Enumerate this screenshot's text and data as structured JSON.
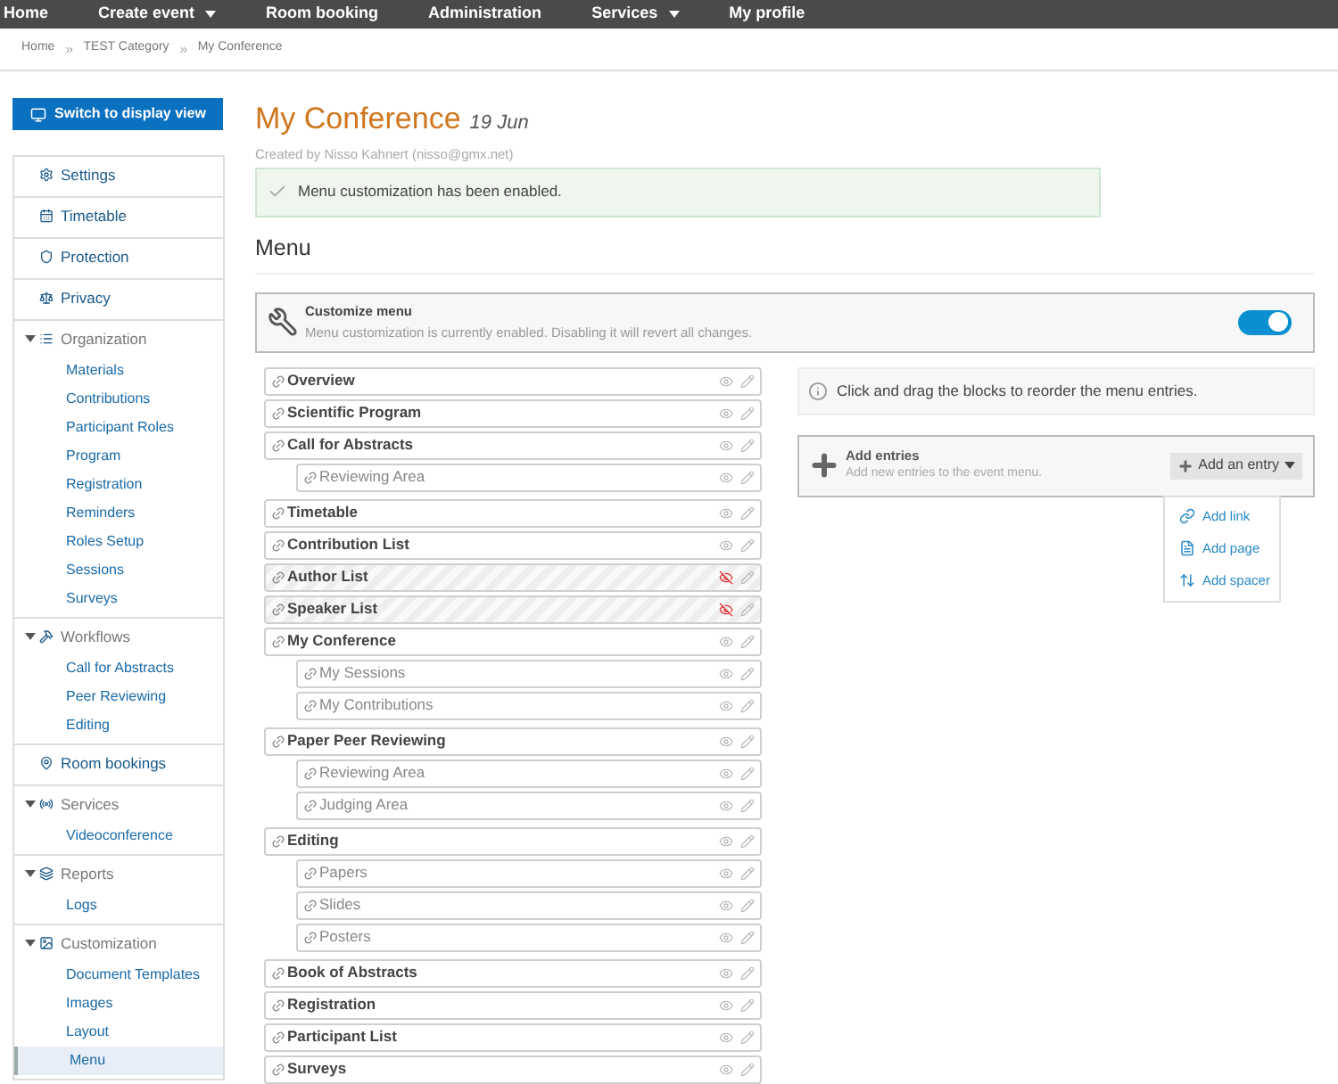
{
  "nav": [
    {
      "label": "Home",
      "dropdown": false
    },
    {
      "label": "Create event",
      "dropdown": true
    },
    {
      "label": "Room booking",
      "dropdown": false
    },
    {
      "label": "Administration",
      "dropdown": false
    },
    {
      "label": "Services",
      "dropdown": true
    },
    {
      "label": "My profile",
      "dropdown": false
    }
  ],
  "breadcrumb": [
    "Home",
    "TEST Category",
    "My Conference"
  ],
  "sidebar": {
    "display_view_button": "Switch to display view",
    "sections": [
      {
        "label": "Settings"
      },
      {
        "label": "Timetable"
      },
      {
        "label": "Protection"
      },
      {
        "label": "Privacy"
      },
      {
        "label": "Organization",
        "expanded": true,
        "items": [
          {
            "label": "Materials",
            "selected": false
          },
          {
            "label": "Contributions",
            "selected": false
          },
          {
            "label": "Participant Roles",
            "selected": false
          },
          {
            "label": "Program",
            "selected": false
          },
          {
            "label": "Registration",
            "selected": false
          },
          {
            "label": "Reminders",
            "selected": false
          },
          {
            "label": "Roles Setup",
            "selected": false
          },
          {
            "label": "Sessions",
            "selected": false
          },
          {
            "label": "Surveys",
            "selected": false
          }
        ]
      },
      {
        "label": "Workflows",
        "expanded": true,
        "items": [
          {
            "label": "Call for Abstracts",
            "selected": false
          },
          {
            "label": "Peer Reviewing",
            "selected": false
          },
          {
            "label": "Editing",
            "selected": false
          }
        ]
      },
      {
        "label": "Room bookings"
      },
      {
        "label": "Services",
        "expanded": true,
        "items": [
          {
            "label": "Videoconference",
            "selected": false
          }
        ]
      },
      {
        "label": "Reports",
        "expanded": true,
        "items": [
          {
            "label": "Logs",
            "selected": false
          }
        ]
      },
      {
        "label": "Customization",
        "expanded": true,
        "items": [
          {
            "label": "Document Templates",
            "selected": false
          },
          {
            "label": "Images",
            "selected": false
          },
          {
            "label": "Layout",
            "selected": false
          },
          {
            "label": "Menu",
            "selected": true
          }
        ]
      }
    ]
  },
  "event": {
    "title": "My Conference",
    "date": "19 Jun",
    "created_by": "Created by Nisso Kahnert (nisso@gmx.net)"
  },
  "alert": "Menu customization has been enabled.",
  "heading": "Menu",
  "customize": {
    "title": "Customize menu",
    "description": "Menu customization is currently enabled. Disabling it will revert all changes.",
    "on": true
  },
  "entries": [
    {
      "label": "Overview",
      "visible": true
    },
    {
      "label": "Scientific Program",
      "visible": true
    },
    {
      "label": "Call for Abstracts",
      "visible": true,
      "children": [
        {
          "label": "Reviewing Area",
          "visible": true
        }
      ]
    },
    {
      "label": "Timetable",
      "visible": true
    },
    {
      "label": "Contribution List",
      "visible": true
    },
    {
      "label": "Author List",
      "visible": false
    },
    {
      "label": "Speaker List",
      "visible": false
    },
    {
      "label": "My Conference",
      "visible": true,
      "children": [
        {
          "label": "My Sessions",
          "visible": true
        },
        {
          "label": "My Contributions",
          "visible": true
        }
      ]
    },
    {
      "label": "Paper Peer Reviewing",
      "visible": true,
      "children": [
        {
          "label": "Reviewing Area",
          "visible": true
        },
        {
          "label": "Judging Area",
          "visible": true
        }
      ]
    },
    {
      "label": "Editing",
      "visible": true,
      "children": [
        {
          "label": "Papers",
          "visible": true
        },
        {
          "label": "Slides",
          "visible": true
        },
        {
          "label": "Posters",
          "visible": true
        }
      ]
    },
    {
      "label": "Book of Abstracts",
      "visible": true
    },
    {
      "label": "Registration",
      "visible": true
    },
    {
      "label": "Participant List",
      "visible": true
    },
    {
      "label": "Surveys",
      "visible": true
    }
  ],
  "info": "Click and drag the blocks to reorder the menu entries.",
  "add_entries": {
    "title": "Add entries",
    "description": "Add new entries to the event menu.",
    "button": "Add an entry",
    "menu": [
      "Add link",
      "Add page",
      "Add spacer"
    ]
  }
}
